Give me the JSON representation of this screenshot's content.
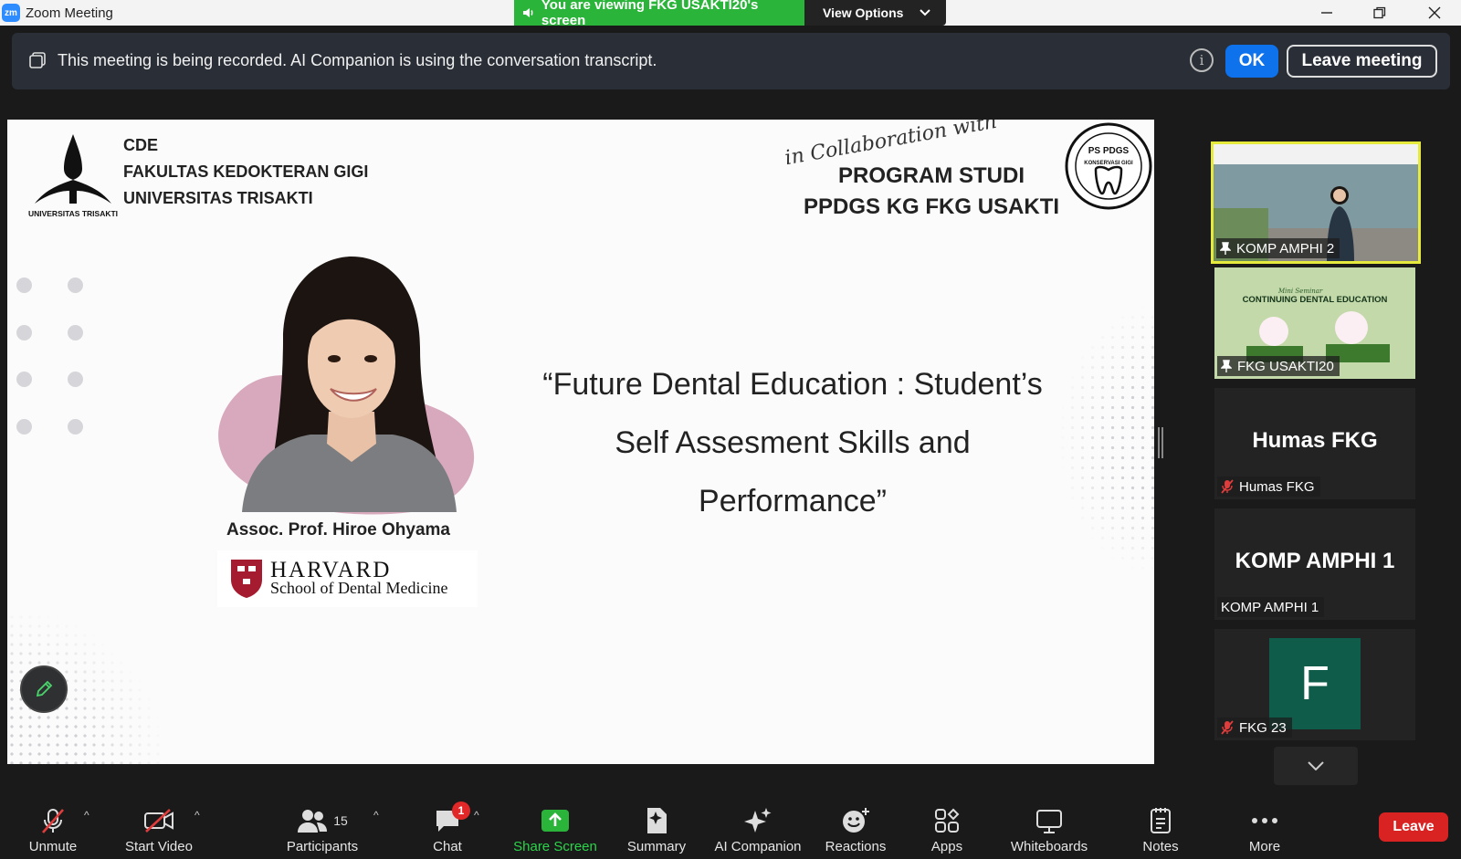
{
  "window": {
    "app_title": "Zoom Meeting",
    "logo_text": "zm",
    "viewing_banner": "You are viewing FKG USAKTI20's screen",
    "view_options": "View Options"
  },
  "recording_bar": {
    "message": "This meeting is being recorded. AI Companion is using the conversation transcript.",
    "ok_label": "OK",
    "leave_label": "Leave meeting"
  },
  "slide": {
    "institution_lines": [
      "CDE",
      "FAKULTAS KEDOKTERAN GIGI",
      "UNIVERSITAS TRISAKTI"
    ],
    "ut_logo_caption": "UNIVERSITAS TRISAKTI",
    "collab_script": "in Collaboration with",
    "program_line1": "PROGRAM STUDI",
    "program_line2": "PPDGS KG FKG USAKTI",
    "pdgs_logo_text": "PS PDGS",
    "pdgs_logo_sub": "KONSERVASI GIGI",
    "talk_title_lines": [
      "“Future Dental Education : Student’s",
      "Self Assesment Skills and",
      "Performance”"
    ],
    "speaker_name": "Assoc. Prof. Hiroe Ohyama",
    "harvard_name": "HARVARD",
    "harvard_sub": "School of Dental Medicine"
  },
  "gallery": [
    {
      "name": "KOMP AMPHI 2",
      "type": "video",
      "active": true
    },
    {
      "name": "FKG USAKTI20",
      "type": "screen"
    },
    {
      "name": "Humas FKG",
      "display": "Humas FKG",
      "muted": true
    },
    {
      "name": "KOMP AMPHI 1",
      "display": "KOMP AMPHI 1",
      "muted": false
    },
    {
      "name": "FKG 23",
      "avatar_letter": "F",
      "muted": true
    }
  ],
  "screen_thumb": {
    "series": "Mini Seminar",
    "title": "CONTINUING DENTAL EDUCATION"
  },
  "toolbar": {
    "unmute": "Unmute",
    "start_video": "Start Video",
    "participants": "Participants",
    "participants_count": "15",
    "chat": "Chat",
    "chat_badge": "1",
    "share_screen": "Share Screen",
    "summary": "Summary",
    "ai_companion": "AI Companion",
    "reactions": "Reactions",
    "apps": "Apps",
    "whiteboards": "Whiteboards",
    "notes": "Notes",
    "more": "More",
    "leave": "Leave"
  },
  "colors": {
    "accent_blue": "#0e72ed",
    "share_green": "#2bb43a",
    "leave_red": "#d92323",
    "active_speaker_border": "#e6ea3c"
  }
}
